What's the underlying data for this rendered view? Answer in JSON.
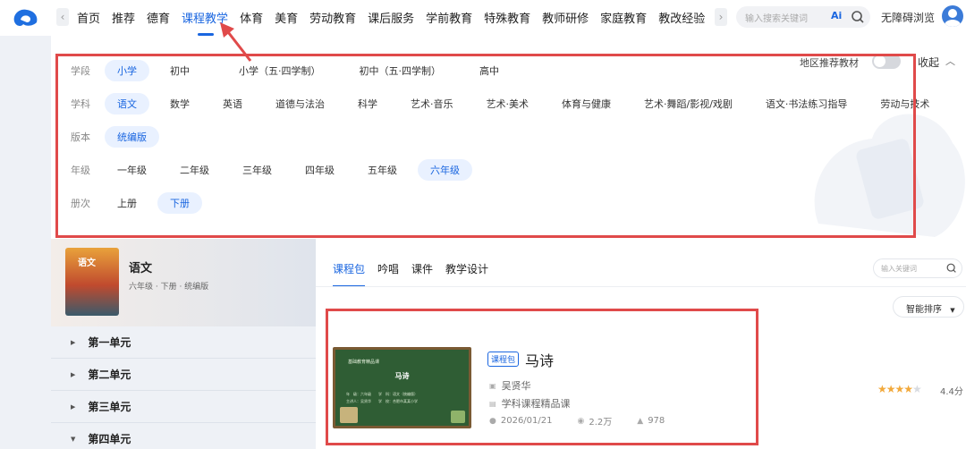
{
  "nav": {
    "items": [
      "首页",
      "推荐",
      "德育",
      "课程教学",
      "体育",
      "美育",
      "劳动教育",
      "课后服务",
      "学前教育",
      "特殊教育",
      "教师研修",
      "家庭教育",
      "教改经验"
    ],
    "active_index": 3,
    "search_placeholder": "输入搜索关键词",
    "ai_label": "Ai",
    "accessibility": "无障碍浏览"
  },
  "filters": {
    "rows": [
      {
        "label": "学段",
        "options": [
          "小学",
          "初中",
          "小学（五·四学制）",
          "初中（五·四学制）",
          "高中"
        ],
        "selected": "小学"
      },
      {
        "label": "学科",
        "options": [
          "语文",
          "数学",
          "英语",
          "道德与法治",
          "科学",
          "艺术·音乐",
          "艺术·美术",
          "体育与健康",
          "艺术·舞蹈/影视/戏剧",
          "语文·书法练习指导",
          "劳动与技术"
        ],
        "selected": "语文"
      },
      {
        "label": "版本",
        "options": [
          "统编版"
        ],
        "selected": "统编版"
      },
      {
        "label": "年级",
        "options": [
          "一年级",
          "二年级",
          "三年级",
          "四年级",
          "五年级",
          "六年级"
        ],
        "selected": "六年级"
      },
      {
        "label": "册次",
        "options": [
          "上册",
          "下册"
        ],
        "selected": "下册"
      }
    ],
    "region_label": "地区推荐教材",
    "region_toggle": "off",
    "collapse_label": "收起"
  },
  "book": {
    "title": "语文",
    "meta": "六年级 · 下册 · 统编版",
    "cover_text": "语文"
  },
  "units": [
    "第一单元",
    "第二单元",
    "第三单元",
    "第四单元"
  ],
  "tabs": [
    "课程包",
    "吟唱",
    "课件",
    "教学设计"
  ],
  "content_search_placeholder": "输入关键词",
  "sort_label": "智能排序",
  "course": {
    "badge": "课程包",
    "title": "马诗",
    "teacher": "吴贤华",
    "category": "学科课程精品课",
    "date": "2026/01/21",
    "views": "2.2万",
    "likes": "978",
    "rating": "4.4分",
    "stars": 4.4,
    "thumb_header": "基础教育精品课",
    "thumb_title": "马诗",
    "thumb_lines": [
      "年　级：六年级　　学　科：语文（统编版）",
      "主讲人：吴贤华　　学　校：合肥市某某小学"
    ]
  },
  "colors": {
    "accent": "#1a66e0",
    "highlight_box": "#e04a4a"
  }
}
